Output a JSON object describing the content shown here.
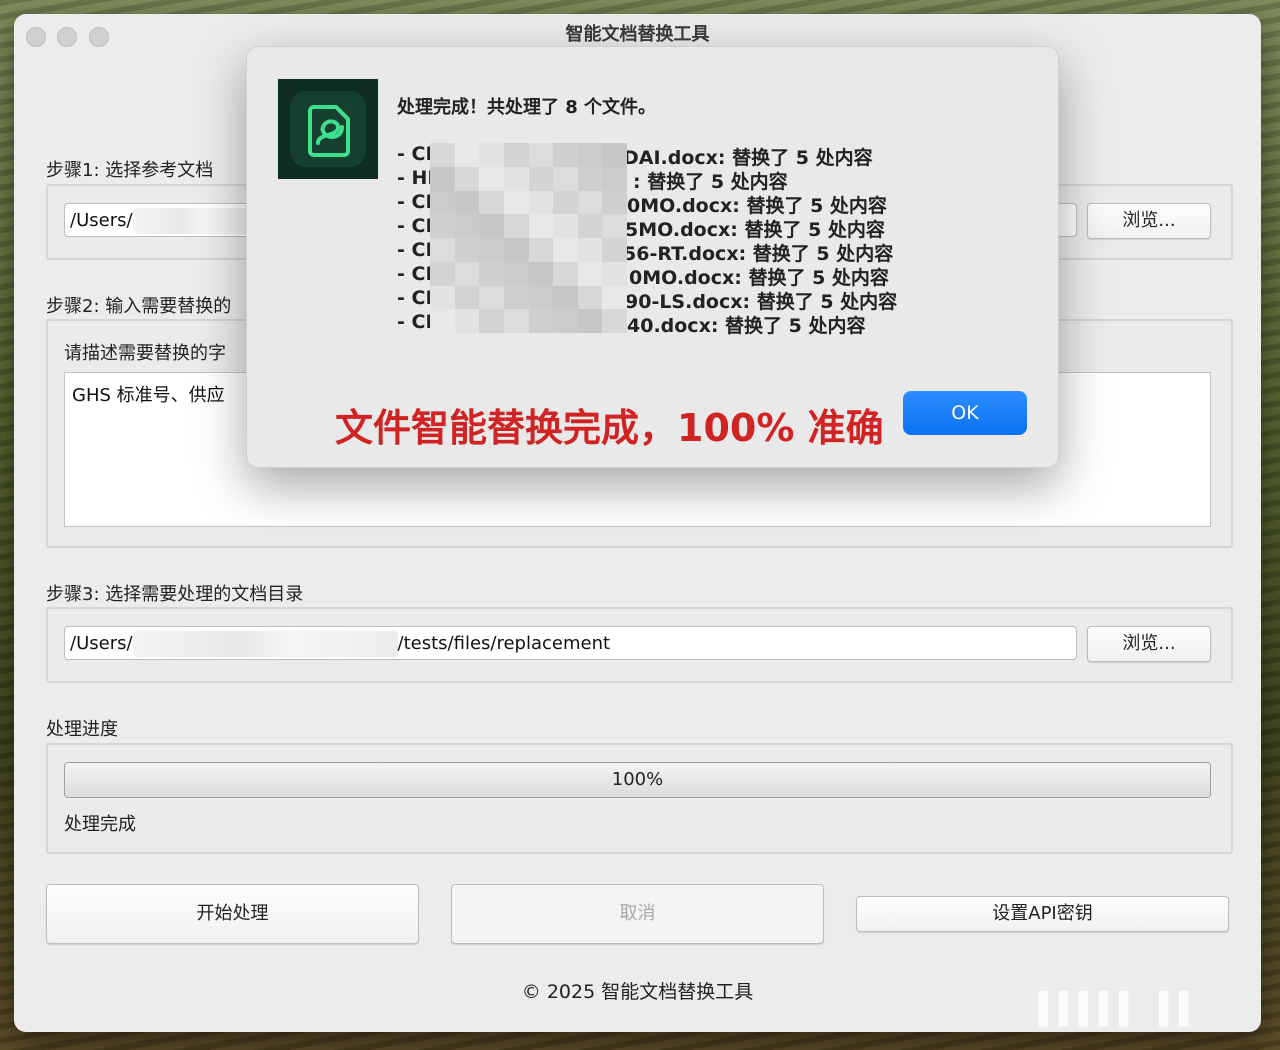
{
  "window": {
    "title": "智能文档替换工具"
  },
  "step1": {
    "label": "步骤1: 选择参考文档",
    "path_prefix": "/Users/",
    "path_suffix": "",
    "browse_label": "浏览..."
  },
  "step2": {
    "label": "步骤2: 输入需要替换的",
    "hint": "请描述需要替换的字",
    "text": "GHS 标准号、供应"
  },
  "step3": {
    "label": "步骤3: 选择需要处理的文档目录",
    "path_prefix": "/Users/",
    "path_suffix": "/tests/files/replacement",
    "browse_label": "浏览..."
  },
  "progress": {
    "label": "处理进度",
    "percent_text": "100%",
    "value": 1.0,
    "status": "处理完成"
  },
  "actions": {
    "start_label": "开始处理",
    "cancel_label": "取消",
    "api_label": "设置API密钥"
  },
  "footer": {
    "copyright": "© 2025 智能文档替换工具"
  },
  "dialog": {
    "title": "处理完成！共处理了 8 个文件。",
    "lines": [
      {
        "prefix": "- CI",
        "suffix": "DAI.docx: 替换了 5 处内容"
      },
      {
        "prefix": "- HI",
        "suffix": ": 替换了 5 处内容"
      },
      {
        "prefix": "- CI",
        "suffix": "0MO.docx: 替换了 5 处内容"
      },
      {
        "prefix": "- CI",
        "suffix": "5MO.docx: 替换了 5 处内容"
      },
      {
        "prefix": "- CI",
        "suffix": "56-RT.docx: 替换了 5 处内容"
      },
      {
        "prefix": "- CI",
        "suffix": "0MO.docx: 替换了 5 处内容"
      },
      {
        "prefix": "- CI",
        "suffix": "90-LS.docx: 替换了 5 处内容"
      },
      {
        "prefix": "- CI",
        "suffix": "40.docx: 替换了 5 处内容"
      }
    ],
    "ok_label": "OK",
    "highlight": "文件智能替换完成，100% 准确"
  },
  "colors": {
    "accent": "#0a72f0",
    "highlight": "#d02424"
  }
}
